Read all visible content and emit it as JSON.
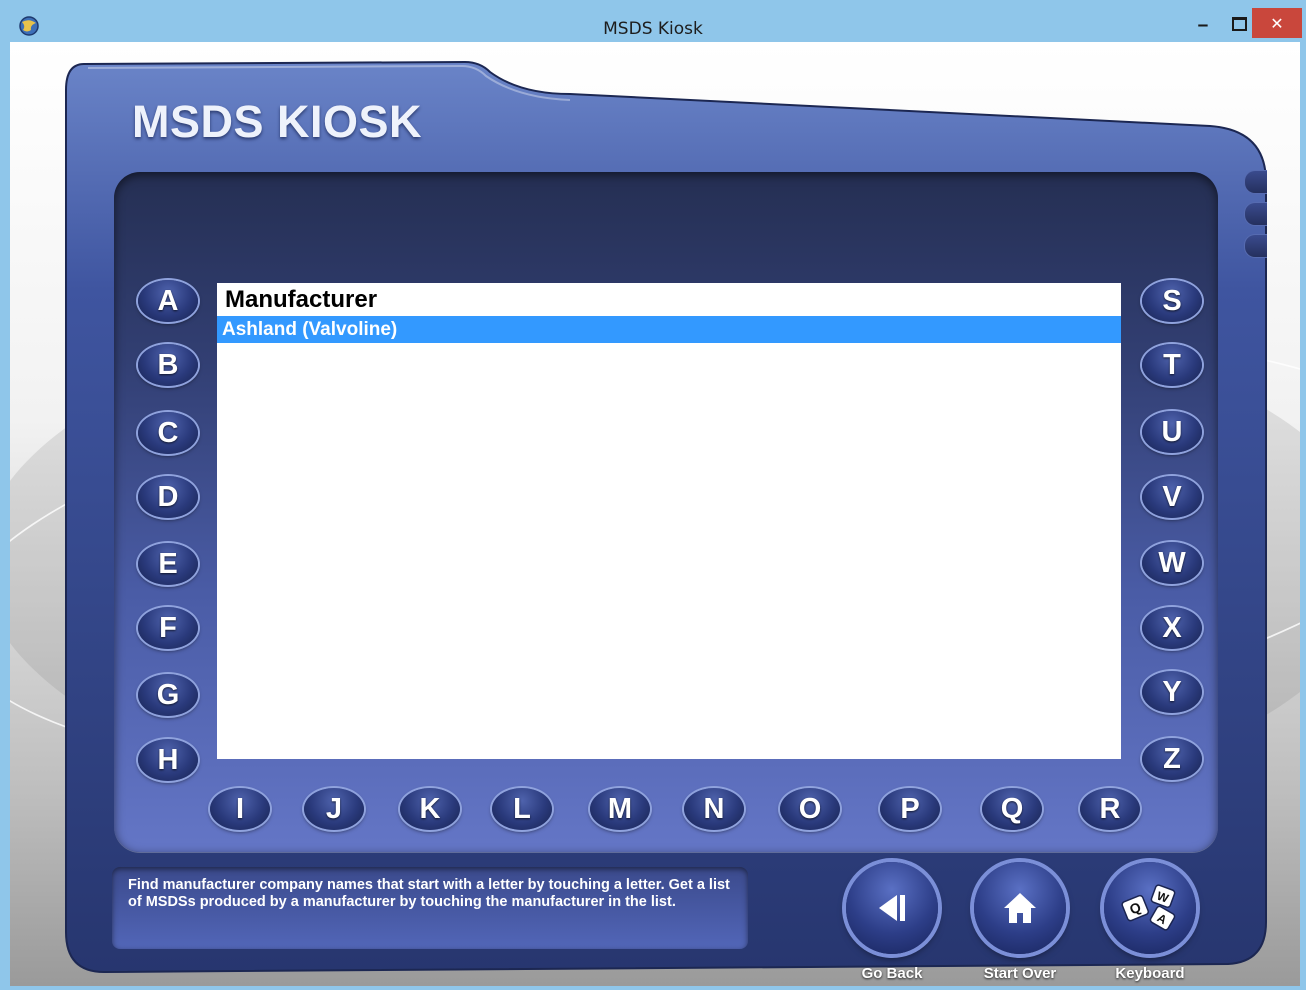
{
  "window": {
    "title": "MSDS Kiosk",
    "minimize_glyph": "‒",
    "close_glyph": "✕"
  },
  "kiosk": {
    "title": "MSDS KIOSK"
  },
  "list": {
    "header": "Manufacturer",
    "rows": [
      "Ashland (Valvoline)"
    ],
    "selected_color": "#3399ff"
  },
  "letters": {
    "left": [
      "A",
      "B",
      "C",
      "D",
      "E",
      "F",
      "G",
      "H"
    ],
    "bottom": [
      "I",
      "J",
      "K",
      "L",
      "M",
      "N",
      "O",
      "P",
      "Q",
      "R"
    ],
    "right": [
      "S",
      "T",
      "U",
      "V",
      "W",
      "X",
      "Y",
      "Z"
    ]
  },
  "info_text": "Find manufacturer company names that start with a letter by touching a letter. Get a list of MSDSs produced by a manufacturer by touching the manufacturer in the list.",
  "nav": {
    "go_back": "Go Back",
    "start_over": "Start Over",
    "keyboard": "Keyboard",
    "keyboard_keys": [
      "Q",
      "W",
      "A"
    ]
  },
  "colors": {
    "titlebar": "#8fc6ea",
    "panel": "#3a4a8c",
    "close_button": "#c9473c"
  }
}
